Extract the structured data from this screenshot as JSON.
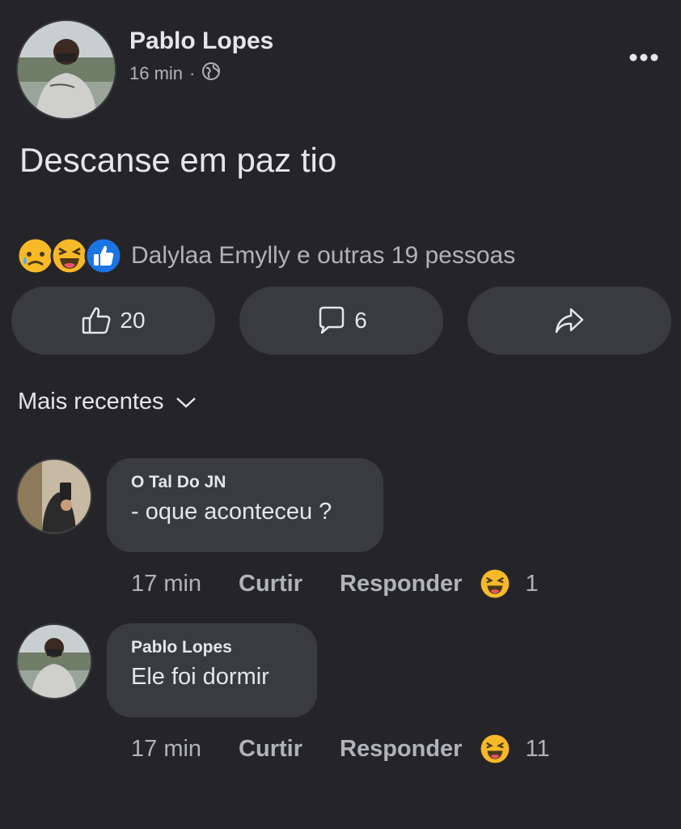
{
  "post": {
    "author": "Pablo Lopes",
    "time": "16 min",
    "separator": "·",
    "text": "Descanse em paz tio",
    "reaction_summary": "Dalylaa Emylly e outras 19 pessoas",
    "reaction_icons": [
      "sad-emoji-icon",
      "haha-emoji-icon",
      "like-icon"
    ],
    "like_count": "20",
    "comment_count": "6"
  },
  "sort": {
    "label": "Mais recentes"
  },
  "comments": [
    {
      "author": "O Tal Do JN",
      "text": "- oque aconteceu ?",
      "time": "17 min",
      "like_label": "Curtir",
      "reply_label": "Responder",
      "reaction_icon": "haha-emoji-icon",
      "reaction_count": "1"
    },
    {
      "author": "Pablo Lopes",
      "text": "Ele foi dormir",
      "time": "17 min",
      "like_label": "Curtir",
      "reply_label": "Responder",
      "reaction_icon": "haha-emoji-icon",
      "reaction_count": "11"
    }
  ],
  "colors": {
    "background": "#252529",
    "surface": "#3a3b3f",
    "text_primary": "#e4e6eb",
    "text_secondary": "#b0b3b8",
    "like_blue": "#1b74e4",
    "emoji_yellow": "#f7b928"
  }
}
